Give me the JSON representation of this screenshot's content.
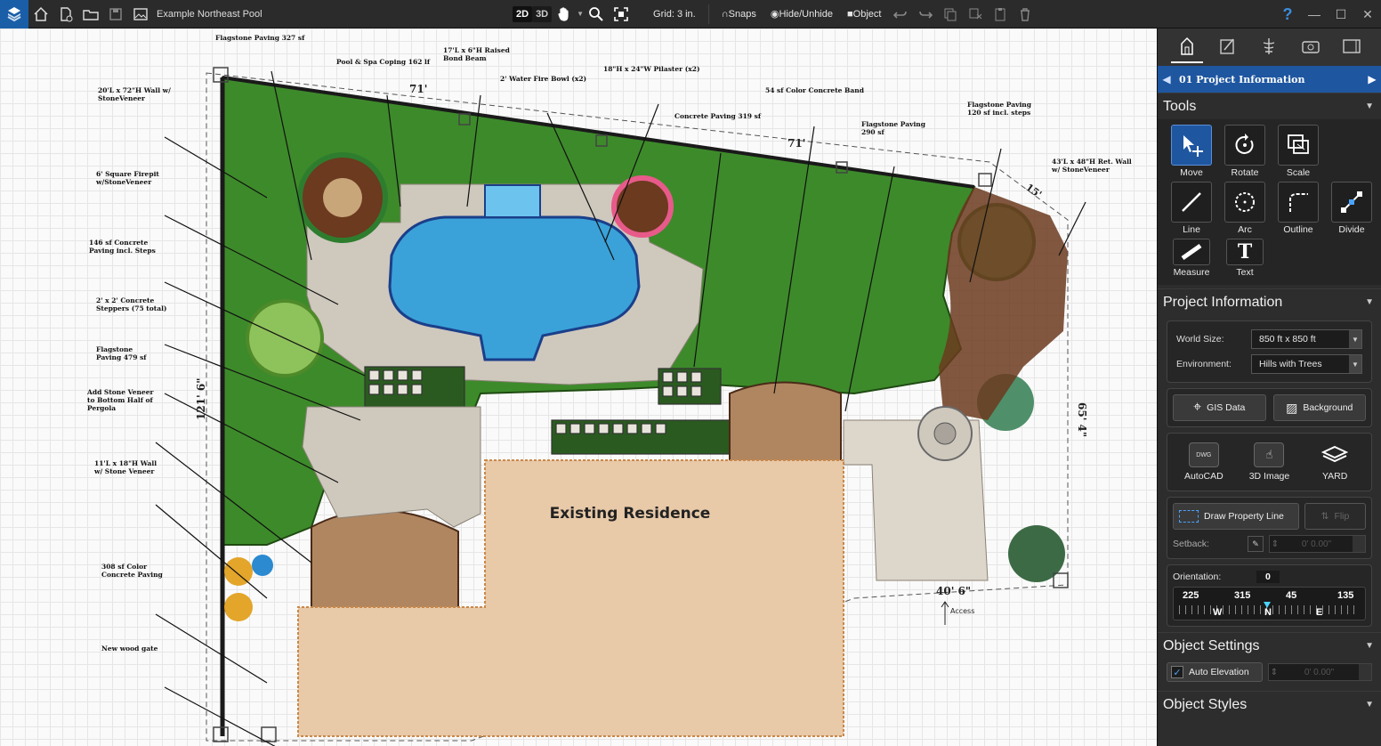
{
  "app": {
    "document_title": "Example Northeast Pool",
    "mode_2d": "2D",
    "mode_3d": "3D",
    "grid_label": "Grid: 3 in.",
    "snaps_label": "Snaps",
    "hide_unhide_label": "Hide/Unhide",
    "object_label": "Object",
    "help_label": "?"
  },
  "panel": {
    "breadcrumb": "01 Project Information",
    "tools_header": "Tools",
    "tools": [
      {
        "label": "Move",
        "icon": "move-icon"
      },
      {
        "label": "Rotate",
        "icon": "rotate-icon"
      },
      {
        "label": "Scale",
        "icon": "scale-icon"
      },
      {
        "label": "Line",
        "icon": "line-icon"
      },
      {
        "label": "Arc",
        "icon": "arc-icon"
      },
      {
        "label": "Outline",
        "icon": "outline-icon"
      },
      {
        "label": "Divide",
        "icon": "divide-icon"
      },
      {
        "label": "Measure",
        "icon": "measure-icon"
      },
      {
        "label": "Text",
        "icon": "text-icon"
      }
    ],
    "project_info_header": "Project Information",
    "world_size_label": "World Size:",
    "world_size_value": "850 ft x 850 ft",
    "environment_label": "Environment:",
    "environment_value": "Hills with Trees",
    "gis_label": "GIS Data",
    "background_label": "Background",
    "autocad_label": "AutoCAD",
    "image3d_label": "3D Image",
    "yard_label": "YARD",
    "draw_property_line_label": "Draw Property Line",
    "flip_label": "Flip",
    "setback_label": "Setback:",
    "setback_value": "0' 0.00\"",
    "orientation_label": "Orientation:",
    "orientation_value": "0",
    "compass_numbers": [
      "225",
      "315",
      "45",
      "135"
    ],
    "compass_letters": [
      "W",
      "N",
      "E"
    ],
    "object_settings_header": "Object Settings",
    "auto_elevation_label": "Auto Elevation",
    "auto_elevation_value": "0' 0.00\"",
    "object_styles_header": "Object Styles"
  },
  "plan": {
    "residence_label": "Existing Residence",
    "dims": {
      "top_left": "71'",
      "top_right": "71'",
      "left": "121' 6\"",
      "right": "65' 4\"",
      "bottom": "40' 6\"",
      "access": "Access",
      "angle": "15'"
    },
    "callouts": [
      "Flagstone Paving 327 sf",
      "Pool & Spa Coping 162 lf",
      "17'L x 6\"H Raised Bond Beam",
      "2' Water Fire Bowl (x2)",
      "18\"H x 24\"W Pilaster (x2)",
      "54 sf Color Concrete Band",
      "Concrete Paving 319 sf",
      "Flagstone Paving 290 sf",
      "Flagstone Paving 120 sf incl. steps",
      "43'L x 48\"H Ret. Wall w/ StoneVeneer",
      "20'L x 72\"H Wall w/ StoneVeneer",
      "6' Square Firepit w/StoneVeneer",
      "146 sf Concrete Paving incl. Steps",
      "2' x 2' Concrete Steppers (75 total)",
      "Flagstone Paving 479 sf",
      "Add Stone Veneer to Bottom Half of Pergola",
      "11'L x 18\"H Wall w/ Stone Veneer",
      "308 sf Color Concrete Paving",
      "New wood gate"
    ]
  }
}
